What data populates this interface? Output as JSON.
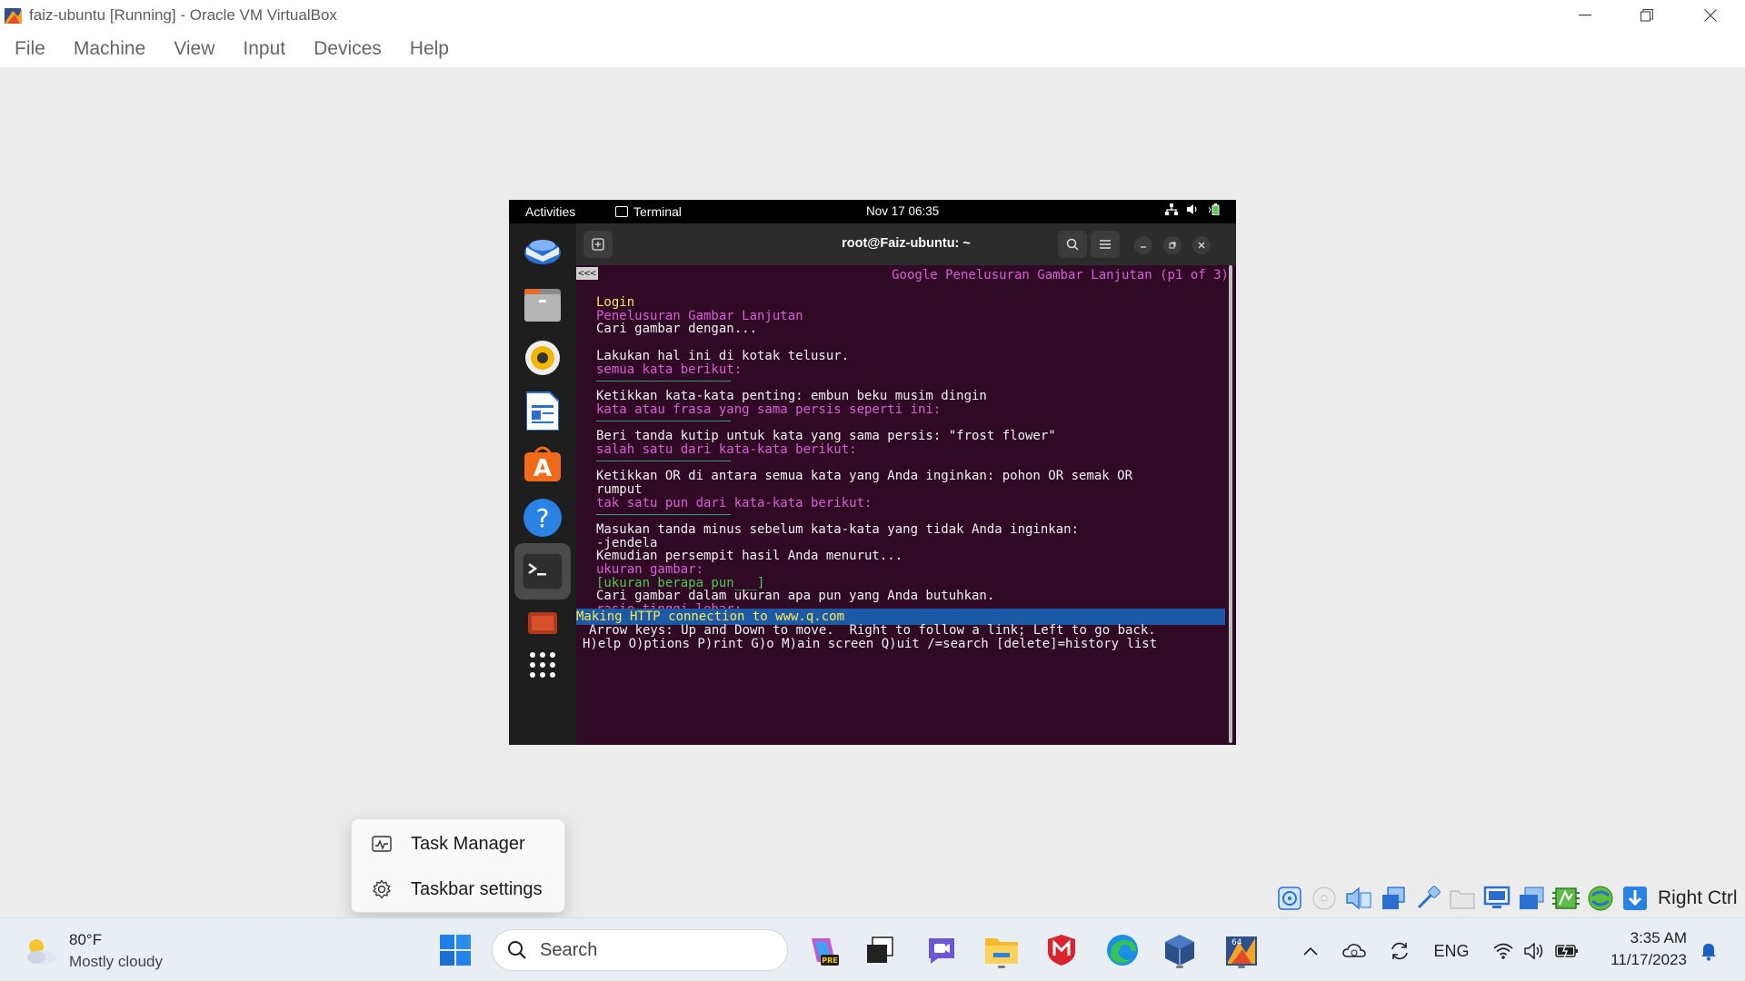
{
  "window": {
    "title": "faiz-ubuntu [Running] - Oracle VM VirtualBox",
    "controls": [
      "minimize",
      "restore",
      "close"
    ]
  },
  "menubar": [
    "File",
    "Machine",
    "View",
    "Input",
    "Devices",
    "Help"
  ],
  "vm": {
    "topbar": {
      "activities": "Activities",
      "app": "Terminal",
      "clock": "Nov 17  06:35"
    },
    "dock": [
      "thunderbird-icon",
      "files-icon",
      "rhythmbox-icon",
      "writer-icon",
      "software-icon",
      "help-icon",
      "terminal-icon",
      "trash-icon",
      "app-grid-icon"
    ],
    "terminal": {
      "title": "root@Faiz-ubuntu: ~",
      "back_marker": "<<<",
      "page_header": "Google Penelusuran Gambar Lanjutan (p1 of 3)",
      "lines": [
        {
          "text": "Login",
          "color": "yel"
        },
        {
          "text": "Penelusuran Gambar Lanjutan",
          "color": "mag"
        },
        {
          "text": "Cari gambar dengan...",
          "color": "white"
        },
        {
          "text": "",
          "color": "white"
        },
        {
          "text": "Lakukan hal ini di kotak telusur.",
          "color": "white"
        },
        {
          "text": "semua kata berikut:",
          "color": "mag"
        },
        {
          "text": "",
          "color": "white"
        },
        {
          "text": "Ketikkan kata-kata penting: embun beku musim dingin",
          "color": "white"
        },
        {
          "text": "kata atau frasa yang sama persis seperti ini:",
          "color": "mag"
        },
        {
          "text": "",
          "color": "white"
        },
        {
          "text": "Beri tanda kutip untuk kata yang sama persis: \"frost flower\"",
          "color": "white"
        },
        {
          "text": "salah satu dari kata-kata berikut:",
          "color": "mag"
        },
        {
          "text": "",
          "color": "white"
        },
        {
          "text": "Ketikkan OR di antara semua kata yang Anda inginkan: pohon OR semak OR",
          "color": "white"
        },
        {
          "text": "rumput",
          "color": "white"
        },
        {
          "text": "tak satu pun dari kata-kata berikut:",
          "color": "mag"
        },
        {
          "text": "",
          "color": "white"
        },
        {
          "text": "Masukan tanda minus sebelum kata-kata yang tidak Anda inginkan:",
          "color": "white"
        },
        {
          "text": "-jendela",
          "color": "white"
        },
        {
          "text": "Kemudian persempit hasil Anda menurut...",
          "color": "white"
        },
        {
          "text": "ukuran gambar:",
          "color": "mag"
        },
        {
          "text": "[ukuran berapa pun___]",
          "color": "grn"
        },
        {
          "text": "Cari gambar dalam ukuran apa pun yang Anda butuhkan.",
          "color": "white"
        },
        {
          "text": "rasio tinggi lebar:",
          "color": "mag"
        }
      ],
      "status_line": "Making HTTP connection to www.q.com",
      "help1": "Arrow keys: Up and Down to move.  Right to follow a link; Left to go back.",
      "help2": "H)elp O)ptions P)rint G)o M)ain screen Q)uit /=search [delete]=history list"
    }
  },
  "context_menu": {
    "items": [
      "Task Manager",
      "Taskbar settings"
    ]
  },
  "vbox_status": {
    "icons": [
      "hard-disk-icon",
      "optical-drive-icon",
      "audio-icon",
      "network-icon",
      "usb-icon",
      "shared-folder-icon",
      "display-icon",
      "recording-icon",
      "cpu-icon",
      "guest-additions-icon",
      "download-icon"
    ],
    "host_key": "Right Ctrl"
  },
  "taskbar": {
    "weather": {
      "temp": "80°F",
      "desc": "Mostly cloudy"
    },
    "search_label": "Search",
    "apps": [
      "start-icon",
      "copilot-pre-icon",
      "task-view-icon",
      "chat-icon",
      "file-explorer-icon",
      "mcafee-icon",
      "edge-icon",
      "virtualbox-cube-icon",
      "virtualbox-icon"
    ],
    "tray": {
      "lang": "ENG",
      "time": "3:35 AM",
      "date": "11/17/2023"
    }
  },
  "colors": {
    "terminal_bg": "#300a24",
    "accent_magenta": "#d75fd7",
    "status_blue": "#1c5aa8",
    "taskbar_bg": "#e9eef5"
  }
}
